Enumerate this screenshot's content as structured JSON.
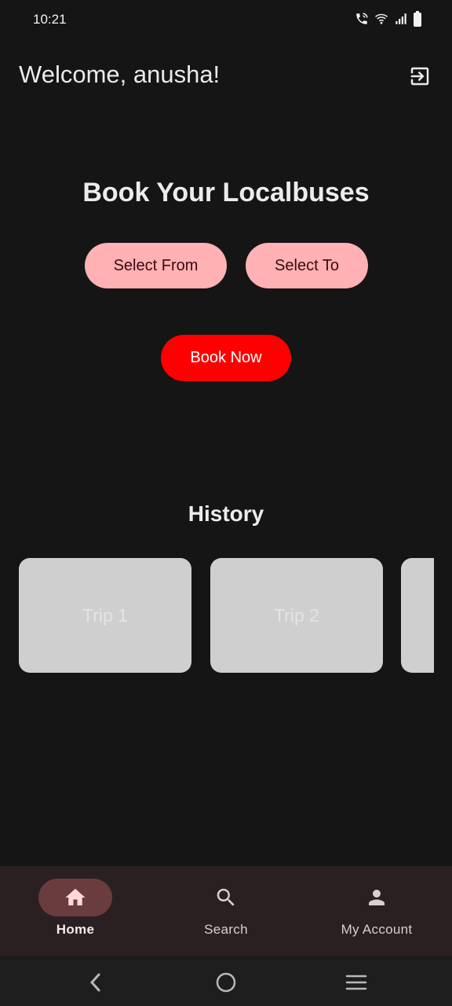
{
  "status_bar": {
    "time": "10:21",
    "icons": [
      "wifi-call-icon",
      "wifi-icon",
      "signal-icon",
      "battery-icon"
    ]
  },
  "header": {
    "welcome": "Welcome, anusha!",
    "logout_icon": "logout-icon"
  },
  "booking": {
    "title": "Book Your Localbuses",
    "select_from": "Select From",
    "select_to": "Select To",
    "book_now": "Book Now"
  },
  "history": {
    "title": "History",
    "trips": [
      "Trip 1",
      "Trip 2",
      ""
    ]
  },
  "bottom_nav": {
    "items": [
      {
        "label": "Home",
        "icon": "home-icon",
        "active": true
      },
      {
        "label": "Search",
        "icon": "search-icon",
        "active": false
      },
      {
        "label": "My Account",
        "icon": "account-icon",
        "active": false
      }
    ]
  },
  "system_nav": [
    "back-icon",
    "home-circle-icon",
    "recents-icon"
  ],
  "colors": {
    "background": "#151515",
    "pill_pink": "#ffb1b3",
    "book_red": "#ff0000",
    "trip_card": "#cfcfcf",
    "nav_bar": "#2a2022",
    "nav_active": "#6a3c3e"
  }
}
